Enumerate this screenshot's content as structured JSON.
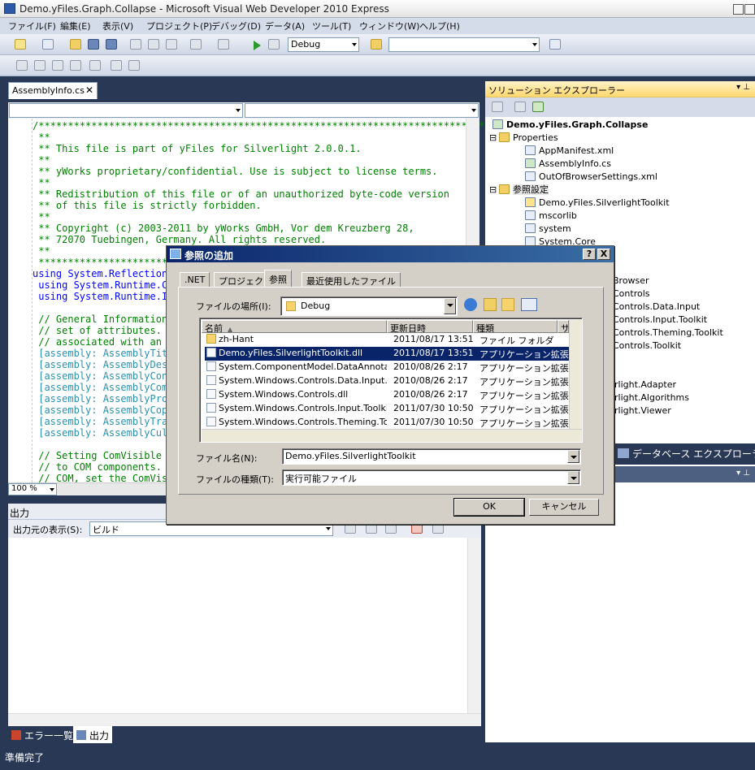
{
  "window": {
    "title": "Demo.yFiles.Graph.Collapse - Microsoft Visual Web Developer 2010 Express"
  },
  "menu": [
    "ファイル(F)",
    "編集(E)",
    "表示(V)",
    "プロジェクト(P)",
    "デバッグ(D)",
    "データ(A)",
    "ツール(T)",
    "ウィンドウ(W)",
    "ヘルプ(H)"
  ],
  "toolbar": {
    "config": "Debug",
    "platform": ""
  },
  "editor": {
    "tab": "AssemblyInfo.cs",
    "zoom": "100 %",
    "lines": [
      "/*******************************************************************************",
      " **",
      " ** This file is part of yFiles for Silverlight 2.0.0.1.",
      " **",
      " ** yWorks proprietary/confidential. Use is subject to license terms.",
      " **",
      " ** Redistribution of this file or of an unauthorized byte-code version",
      " ** of this file is strictly forbidden.",
      " **",
      " ** Copyright (c) 2003-2011 by yWorks GmbH, Vor dem Kreuzberg 28,",
      " ** 72070 Tuebingen, Germany. All rights reserved.",
      " **",
      " ********************************************************************************",
      "using System.Reflection;",
      " using System.Runtime.CompilerServices;",
      " using System.Runtime.InteropServices;",
      "",
      " // General Information about an assembly is controlled through the following",
      " // set of attributes. Change these attribute values to modify the information",
      " // associated with an assembly.",
      " [assembly: AssemblyTitle(\"Demo.yFiles.Graph.Collapse\")]",
      " [assembly: AssemblyDescription(\"\")]",
      " [assembly: AssemblyConfiguration(\"\")]",
      " [assembly: AssemblyCompany(\"\")]",
      " [assembly: AssemblyProduct(\"Demo.yFiles.Graph.Collapse\")]",
      " [assembly: AssemblyCopyright(\"\")]",
      " [assembly: AssemblyTrademark(\"\")]",
      " [assembly: AssemblyCulture(\"\")]",
      "",
      " // Setting ComVisible to false makes the types in this assembly not visible",
      " // to COM components.  If you need to access a type in this assembly from",
      " // COM, set the ComVisible attribute to true on that type."
    ]
  },
  "output": {
    "title": "出力",
    "source_label": "出力元の表示(S):",
    "source_value": "ビルド"
  },
  "bottom_tabs": [
    "エラー一覧",
    "出力"
  ],
  "status": "準備完了",
  "solution": {
    "title": "ソリューション エクスプローラー",
    "project": "Demo.yFiles.Graph.Collapse",
    "items": [
      "Properties",
      "AppManifest.xml",
      "AssemblyInfo.cs",
      "OutOfBrowserSettings.xml",
      "参照設定",
      "Demo.yFiles.SilverlightToolkit",
      "mscorlib",
      "system",
      "System.Core"
    ],
    "hidden_items": [
      "Browser",
      "Controls",
      "Controls.Data.Input",
      "Controls.Input.Toolkit",
      "Controls.Theming.Toolkit",
      "Controls.Toolkit",
      "rlight.Adapter",
      "rlight.Algorithms",
      "rlight.Viewer"
    ],
    "db_tab": "データベース エクスプローラー"
  },
  "dialog": {
    "title": "参照の追加",
    "help_btn": "?",
    "close_btn": "X",
    "tabs": [
      ".NET",
      "プロジェクト",
      "参照",
      "最近使用したファイル"
    ],
    "look_in_label": "ファイルの場所(I):",
    "look_in_value": "Debug",
    "columns": [
      "名前",
      "更新日時",
      "種類",
      "サ"
    ],
    "files": [
      {
        "name": "zh-Hant",
        "date": "2011/08/17 13:51",
        "type": "ファイル フォルダ"
      },
      {
        "name": "Demo.yFiles.SilverlightToolkit.dll",
        "date": "2011/08/17 13:51",
        "type": "アプリケーション拡張"
      },
      {
        "name": "System.ComponentModel.DataAnnotati...",
        "date": "2010/08/26 2:17",
        "type": "アプリケーション拡張"
      },
      {
        "name": "System.Windows.Controls.Data.Input.dll",
        "date": "2010/08/26 2:17",
        "type": "アプリケーション拡張"
      },
      {
        "name": "System.Windows.Controls.dll",
        "date": "2010/08/26 2:17",
        "type": "アプリケーション拡張"
      },
      {
        "name": "System.Windows.Controls.Input.Toolkit....",
        "date": "2011/07/30 10:50",
        "type": "アプリケーション拡張"
      },
      {
        "name": "System.Windows.Controls.Theming.Tool...",
        "date": "2011/07/30 10:50",
        "type": "アプリケーション拡張"
      }
    ],
    "filename_label": "ファイル名(N):",
    "filename_value": "Demo.yFiles.SilverlightToolkit",
    "filetype_label": "ファイルの種類(T):",
    "filetype_value": "実行可能ファイル",
    "ok": "OK",
    "cancel": "キャンセル"
  }
}
